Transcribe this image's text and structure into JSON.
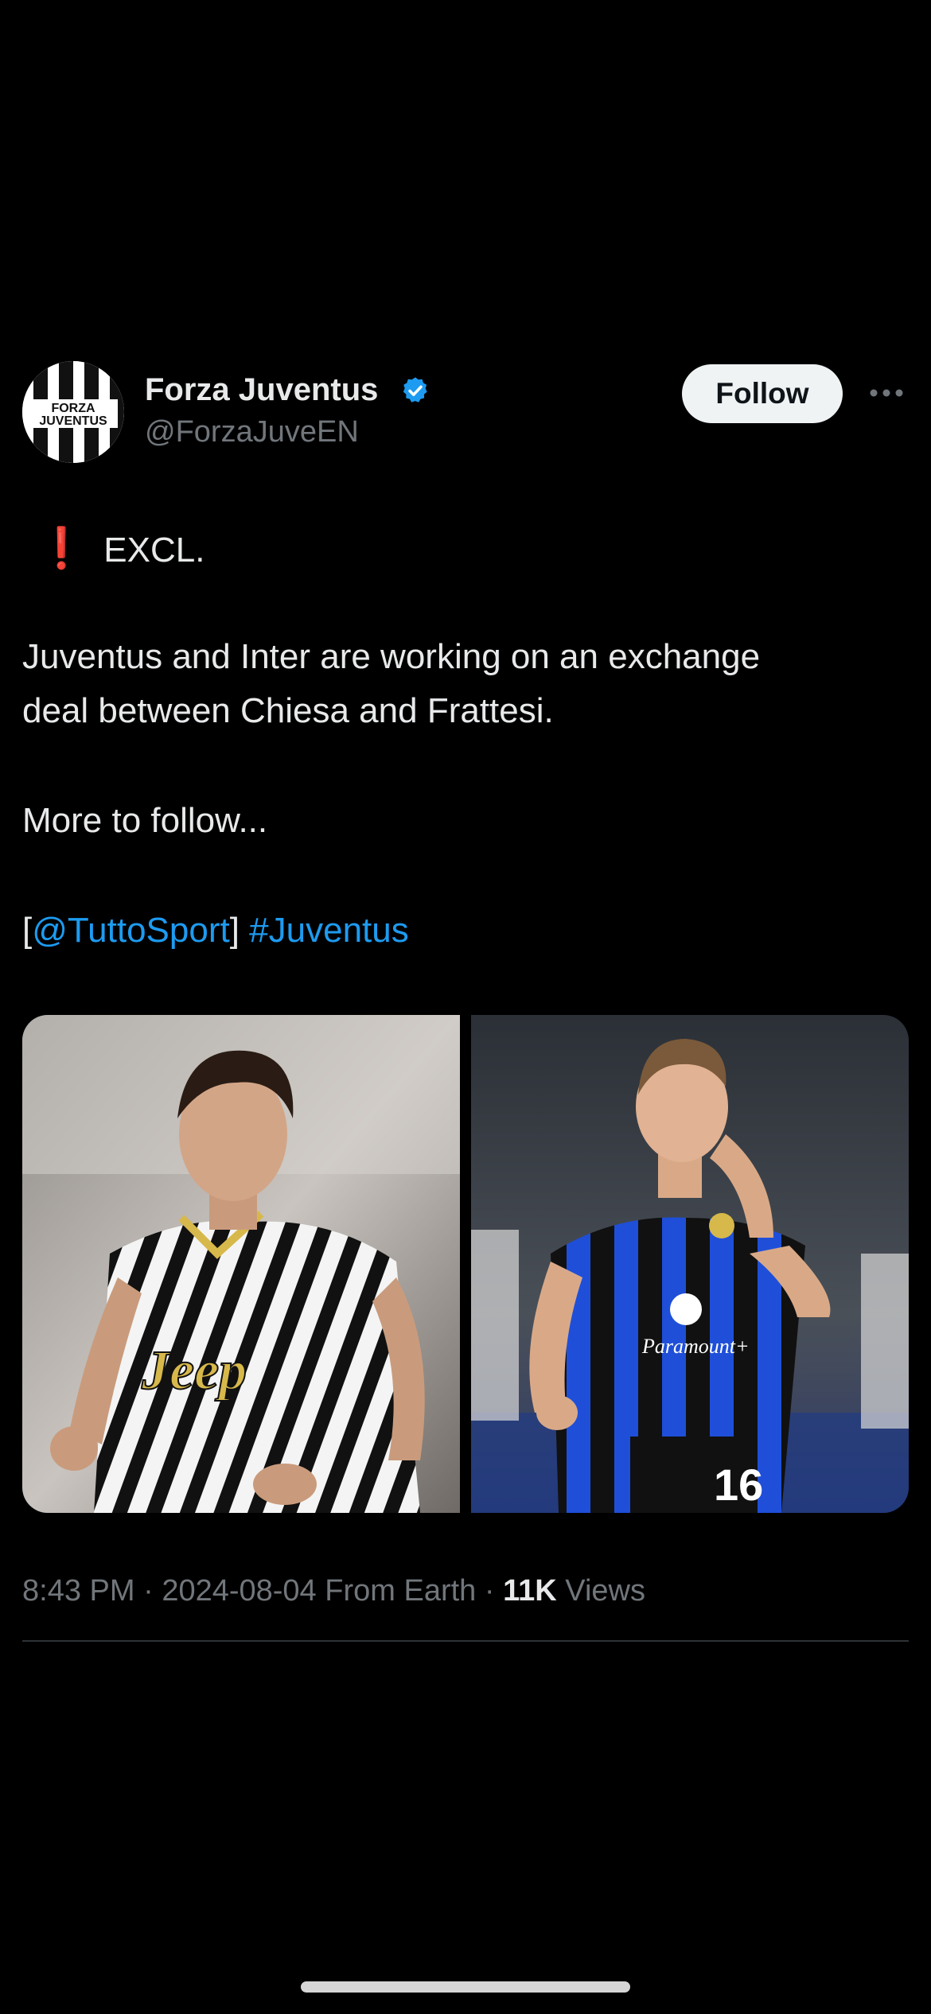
{
  "account": {
    "display_name": "Forza Juventus",
    "handle": "@ForzaJuveEN",
    "verified_icon": "verified-badge-icon",
    "avatar_text_line1": "FORZA",
    "avatar_text_line2": "JUVENTUS"
  },
  "actions": {
    "follow_label": "Follow",
    "more_icon": "more-horizontal-icon"
  },
  "tweet": {
    "excl_icon": "❗",
    "line1": "EXCL.",
    "line2": "Juventus and Inter are working on an exchange",
    "line3": "deal between Chiesa and Frattesi.",
    "line4": "More to follow...",
    "bracket_open": "[",
    "mention": "@TuttoSport",
    "bracket_close": "]",
    "hashtag": "#Juventus"
  },
  "media": {
    "left_player_shirt_text": "Jeep",
    "right_player_shirt_text": "Paramount+",
    "right_player_number": "16"
  },
  "meta": {
    "time": "8:43 PM",
    "separator": "·",
    "date": "2024-08-04",
    "source": "From Earth",
    "views_count": "11K",
    "views_label": "Views"
  },
  "colors": {
    "background": "#000000",
    "text": "#e7e9ea",
    "muted": "#71767b",
    "link": "#1d9bf0",
    "verified": "#1d9bf0",
    "excl": "#e0212e"
  }
}
